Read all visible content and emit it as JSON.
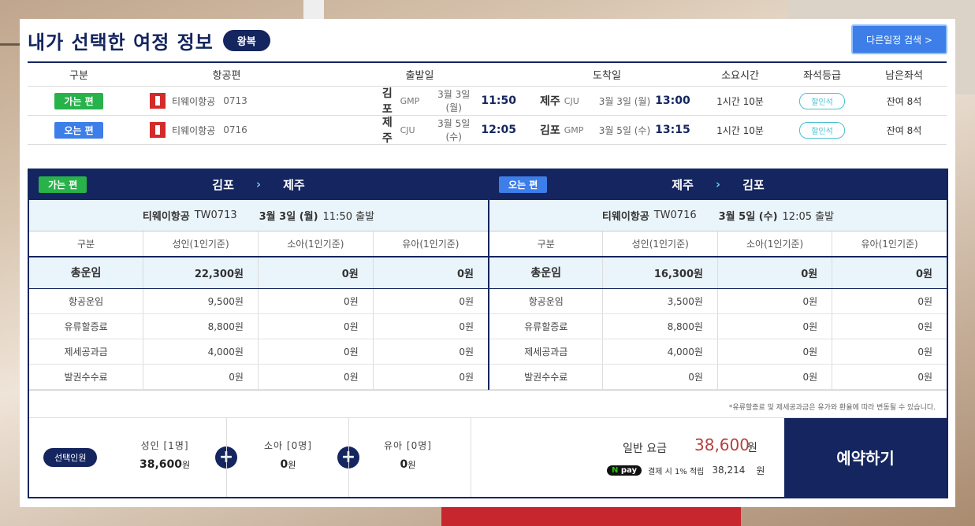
{
  "page": {
    "title": "내가 선택한 여정 정보",
    "trip_type": "왕복",
    "other_schedule_button": "다른일정 검색 >"
  },
  "summary": {
    "headers": [
      "구분",
      "항공편",
      "출발일",
      "도착일",
      "소요시간",
      "좌석등급",
      "남은좌석"
    ],
    "rows": [
      {
        "direction": "가는 편",
        "airline": "티웨이항공",
        "flight_no": "0713",
        "dep_city": "김포",
        "dep_code": "GMP",
        "dep_date": "3월 3일 (월)",
        "dep_time": "11:50",
        "arr_city": "제주",
        "arr_code": "CJU",
        "arr_date": "3월 3일 (월)",
        "arr_time": "13:00",
        "duration": "1시간  10분",
        "seat_class": "할인석",
        "seats_left": "잔여 8석"
      },
      {
        "direction": "오는 편",
        "airline": "티웨이항공",
        "flight_no": "0716",
        "dep_city": "제주",
        "dep_code": "CJU",
        "dep_date": "3월 5일 (수)",
        "dep_time": "12:05",
        "arr_city": "김포",
        "arr_code": "GMP",
        "arr_date": "3월 5일 (수)",
        "arr_time": "13:15",
        "duration": "1시간  10분",
        "seat_class": "할인석",
        "seats_left": "잔여 8석"
      }
    ]
  },
  "fares": {
    "outbound": {
      "direction": "가는 편",
      "from": "김포",
      "to": "제주",
      "airline": "티웨이항공",
      "flight": "TW0713",
      "date": "3월 3일 (월)",
      "departure": "11:50 출발",
      "columns": [
        "구분",
        "성인(1인기준)",
        "소아(1인기준)",
        "유아(1인기준)"
      ],
      "total": [
        "총운임",
        "22,300원",
        "0원",
        "0원"
      ],
      "rows": [
        [
          "항공운임",
          "9,500원",
          "0원",
          "0원"
        ],
        [
          "유류할증료",
          "8,800원",
          "0원",
          "0원"
        ],
        [
          "제세공과금",
          "4,000원",
          "0원",
          "0원"
        ],
        [
          "발권수수료",
          "0원",
          "0원",
          "0원"
        ]
      ]
    },
    "inbound": {
      "direction": "오는 편",
      "from": "제주",
      "to": "김포",
      "airline": "티웨이항공",
      "flight": "TW0716",
      "date": "3월 5일 (수)",
      "departure": "12:05 출발",
      "columns": [
        "구분",
        "성인(1인기준)",
        "소아(1인기준)",
        "유아(1인기준)"
      ],
      "total": [
        "총운임",
        "16,300원",
        "0원",
        "0원"
      ],
      "rows": [
        [
          "항공운임",
          "3,500원",
          "0원",
          "0원"
        ],
        [
          "유류할증료",
          "8,800원",
          "0원",
          "0원"
        ],
        [
          "제세공과금",
          "4,000원",
          "0원",
          "0원"
        ],
        [
          "발권수수료",
          "0원",
          "0원",
          "0원"
        ]
      ]
    },
    "note": "*유류할증료 및 제세공과금은 유가와 환율에 따라 변동될 수 있습니다."
  },
  "booking": {
    "pax_label": "선택인원",
    "adult_label": "성인  [1명]",
    "adult_value": "38,600",
    "child_label": "소아  [0명]",
    "child_value": "0",
    "infant_label": "유아  [0명]",
    "infant_value": "0",
    "won": "원",
    "plus": "+",
    "price_label": "일반 요금",
    "price_value": "38,600",
    "npay_logo": "pay",
    "npay_text": "결제 시 1% 적립",
    "npay_points": "38,214",
    "book_button": "예약하기"
  }
}
